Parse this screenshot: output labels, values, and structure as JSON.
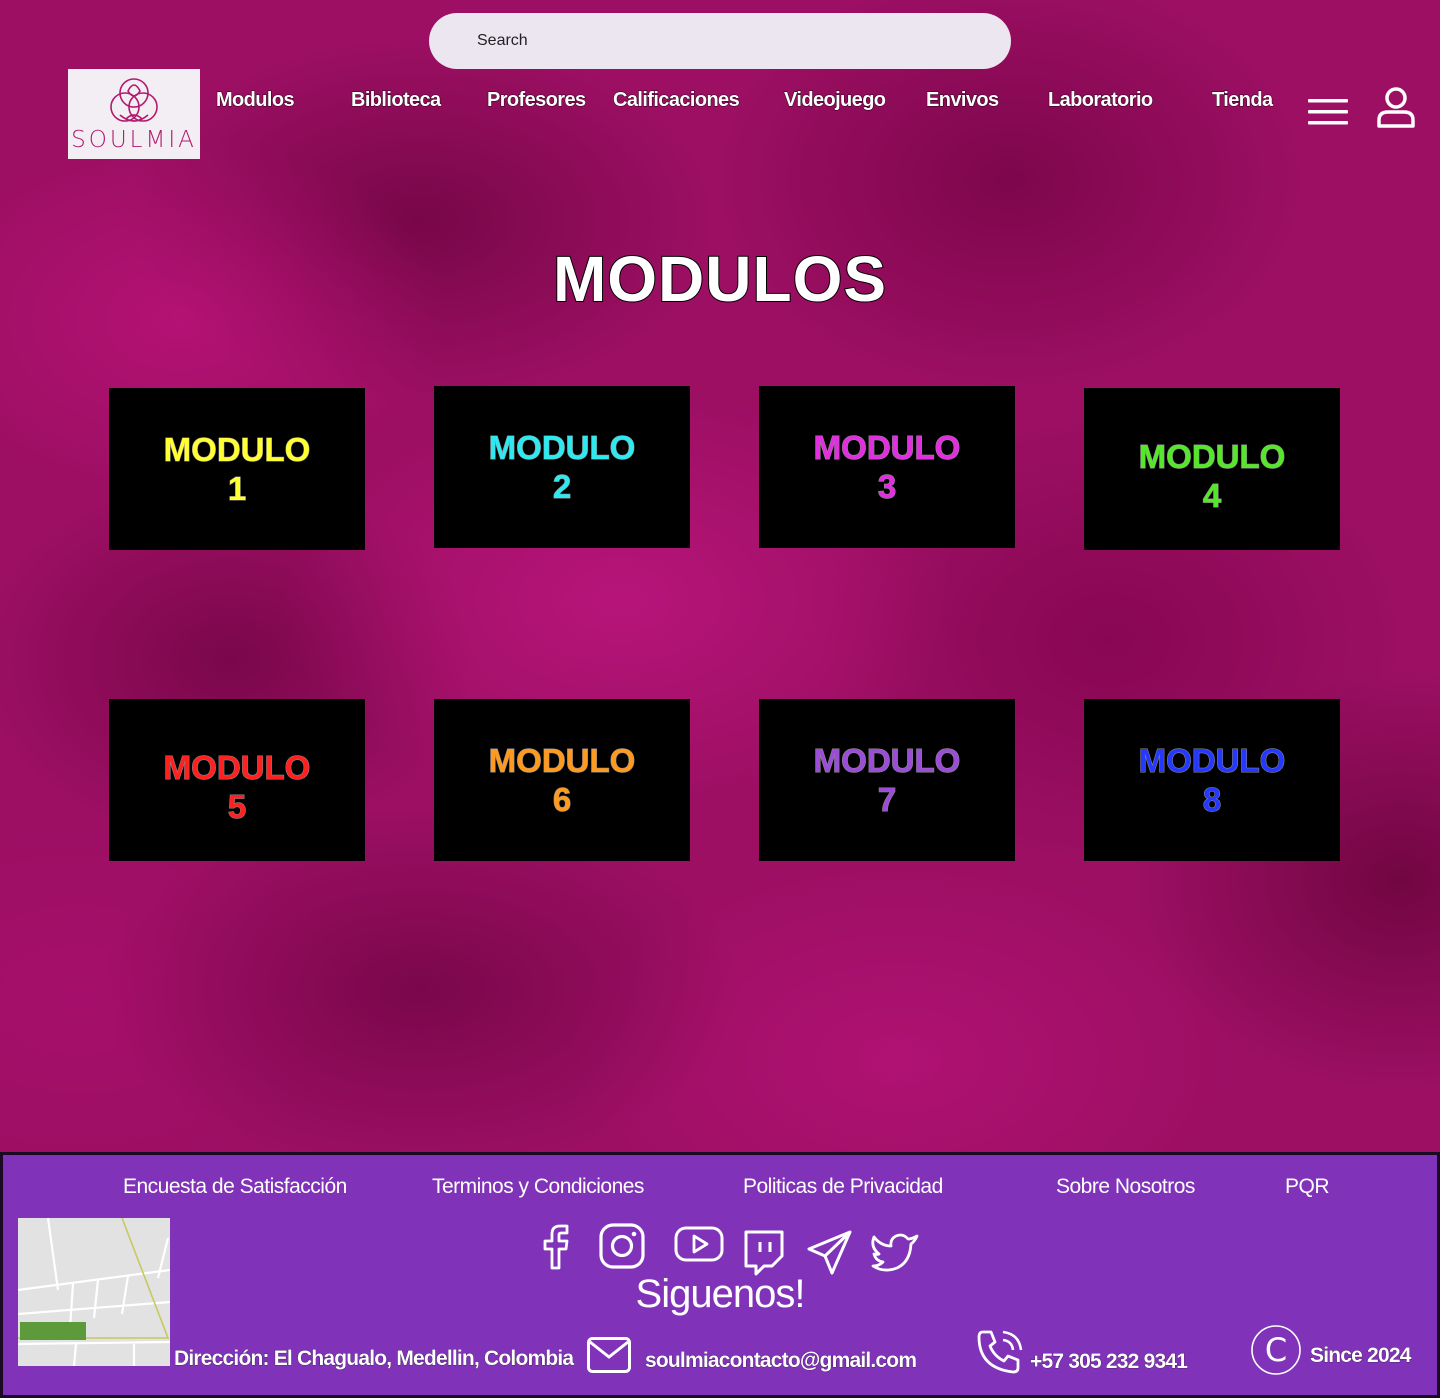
{
  "search": {
    "placeholder": "Search"
  },
  "logo": {
    "text": "SOULMIA",
    "brand_color": "#b01b6d"
  },
  "nav": {
    "items": [
      {
        "label": "Modulos"
      },
      {
        "label": "Biblioteca"
      },
      {
        "label": "Profesores"
      },
      {
        "label": "Calificaciones"
      },
      {
        "label": "Videojuego"
      },
      {
        "label": "Envivos"
      },
      {
        "label": "Laboratorio"
      },
      {
        "label": "Tienda"
      }
    ],
    "menu_icon": "hamburger-menu-icon",
    "user_icon": "user-icon"
  },
  "main": {
    "title": "MODULOS",
    "modules": [
      {
        "word": "MODULO",
        "number": "1",
        "color": "#ffff33"
      },
      {
        "word": "MODULO",
        "number": "2",
        "color": "#2ee9f0"
      },
      {
        "word": "MODULO",
        "number": "3",
        "color": "#e12fe0"
      },
      {
        "word": "MODULO",
        "number": "4",
        "color": "#55e82a"
      },
      {
        "word": "MODULO",
        "number": "5",
        "color": "#ff2020"
      },
      {
        "word": "MODULO",
        "number": "6",
        "color": "#ff9a1f"
      },
      {
        "word": "MODULO",
        "number": "7",
        "color": "#9b4dd8"
      },
      {
        "word": "MODULO",
        "number": "8",
        "color": "#2538ff"
      }
    ]
  },
  "footer": {
    "background": "#8033b8",
    "links": [
      {
        "label": "Encuesta de Satisfacción"
      },
      {
        "label": "Terminos y Condiciones"
      },
      {
        "label": "Politicas de Privacidad"
      },
      {
        "label": "Sobre Nosotros"
      },
      {
        "label": "PQR"
      }
    ],
    "social_icons": [
      "facebook-icon",
      "instagram-icon",
      "youtube-icon",
      "twitch-icon",
      "telegram-icon",
      "twitter-icon"
    ],
    "follow_text": "Siguenos!",
    "address": "Dirección: El Chagualo, Medellin, Colombia",
    "email": "soulmiacontacto@gmail.com",
    "phone": "+57 305 232 9341",
    "since": "Since 2024",
    "copyright_symbol": "C"
  }
}
